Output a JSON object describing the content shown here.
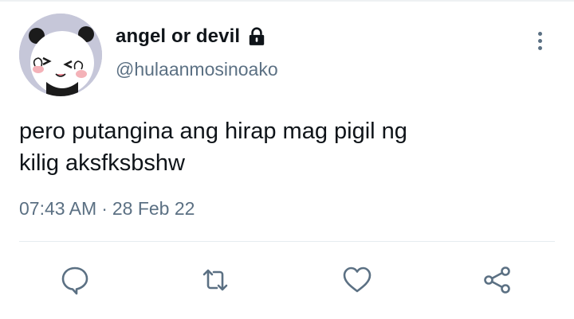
{
  "tweet": {
    "display_name": "angel or devil",
    "handle": "@hulaanmosinoako",
    "text": "pero putangina ang hirap mag pigil ng\nkilig aksfksbshw",
    "time": "07:43 AM",
    "separator": "·",
    "date": "28 Feb 22",
    "protected_icon": "lock-icon",
    "avatar": "panda-sticker-avatar"
  },
  "actions": [
    {
      "name": "reply",
      "icon": "reply-icon"
    },
    {
      "name": "retweet",
      "icon": "retweet-icon"
    },
    {
      "name": "like",
      "icon": "heart-icon"
    },
    {
      "name": "share",
      "icon": "share-icon"
    }
  ],
  "colors": {
    "text_primary": "#0f1419",
    "text_secondary": "#5b7083",
    "divider": "#e6ecf0",
    "avatar_bg": "#c6c7d9"
  }
}
